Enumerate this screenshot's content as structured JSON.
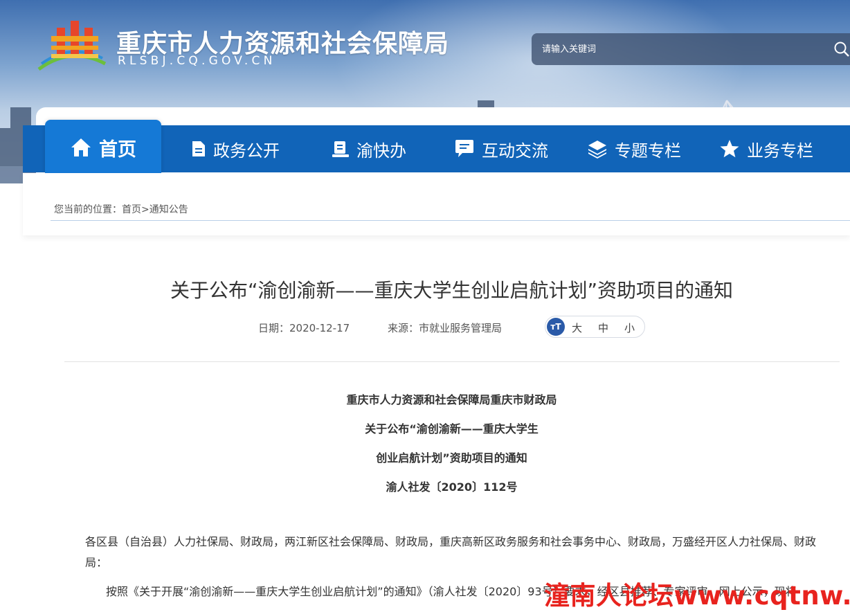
{
  "header": {
    "site_name": "重庆市人力资源和社会保障局",
    "domain": "RLSBJ.CQ.GOV.CN",
    "search_placeholder": "请输入关键词"
  },
  "nav": {
    "items": [
      {
        "label": "首页",
        "icon": "home-icon",
        "active": true
      },
      {
        "label": "政务公开",
        "icon": "document-icon"
      },
      {
        "label": "渝快办",
        "icon": "service-desk-icon"
      },
      {
        "label": "互动交流",
        "icon": "chat-icon"
      },
      {
        "label": "专题专栏",
        "icon": "layers-icon"
      },
      {
        "label": "业务专栏",
        "icon": "star-icon"
      }
    ]
  },
  "breadcrumb": {
    "prefix": "您当前的位置：",
    "home": "首页",
    "sep": ">",
    "current": "通知公告"
  },
  "article": {
    "title": "关于公布“渝创渝新——重庆大学生创业启航计划”资助项目的通知",
    "date": "日期：2020-12-17",
    "source": "来源：市就业服务管理局",
    "font_size": {
      "toggle": "тT",
      "large": "大",
      "medium": "中",
      "small": "小"
    },
    "doc_header": [
      "重庆市人力资源和社会保障局重庆市财政局",
      "关于公布“渝创渝新——重庆大学生",
      "创业启航计划”资助项目的通知",
      "渝人社发〔2020〕112号"
    ],
    "recipients": "各区县（自治县）人力社保局、财政局，两江新区社会保障局、财政局，重庆高新区政务服务和社会事务中心、财政局，万盛经开区人力社保局、财政局：",
    "body_start": "按照《关于开展“渝创渝新——重庆大学生创业启航计划”的通知》（渝人社发〔2020〕93号）要求，经区县推荐、专家评审、网上公示，现将"
  },
  "watermark": "潼南人论坛www.cqtnw.cn",
  "colors": {
    "nav_bg": "#1164b8",
    "nav_active_bg": "#1579d6",
    "watermark": "#e8231e"
  }
}
